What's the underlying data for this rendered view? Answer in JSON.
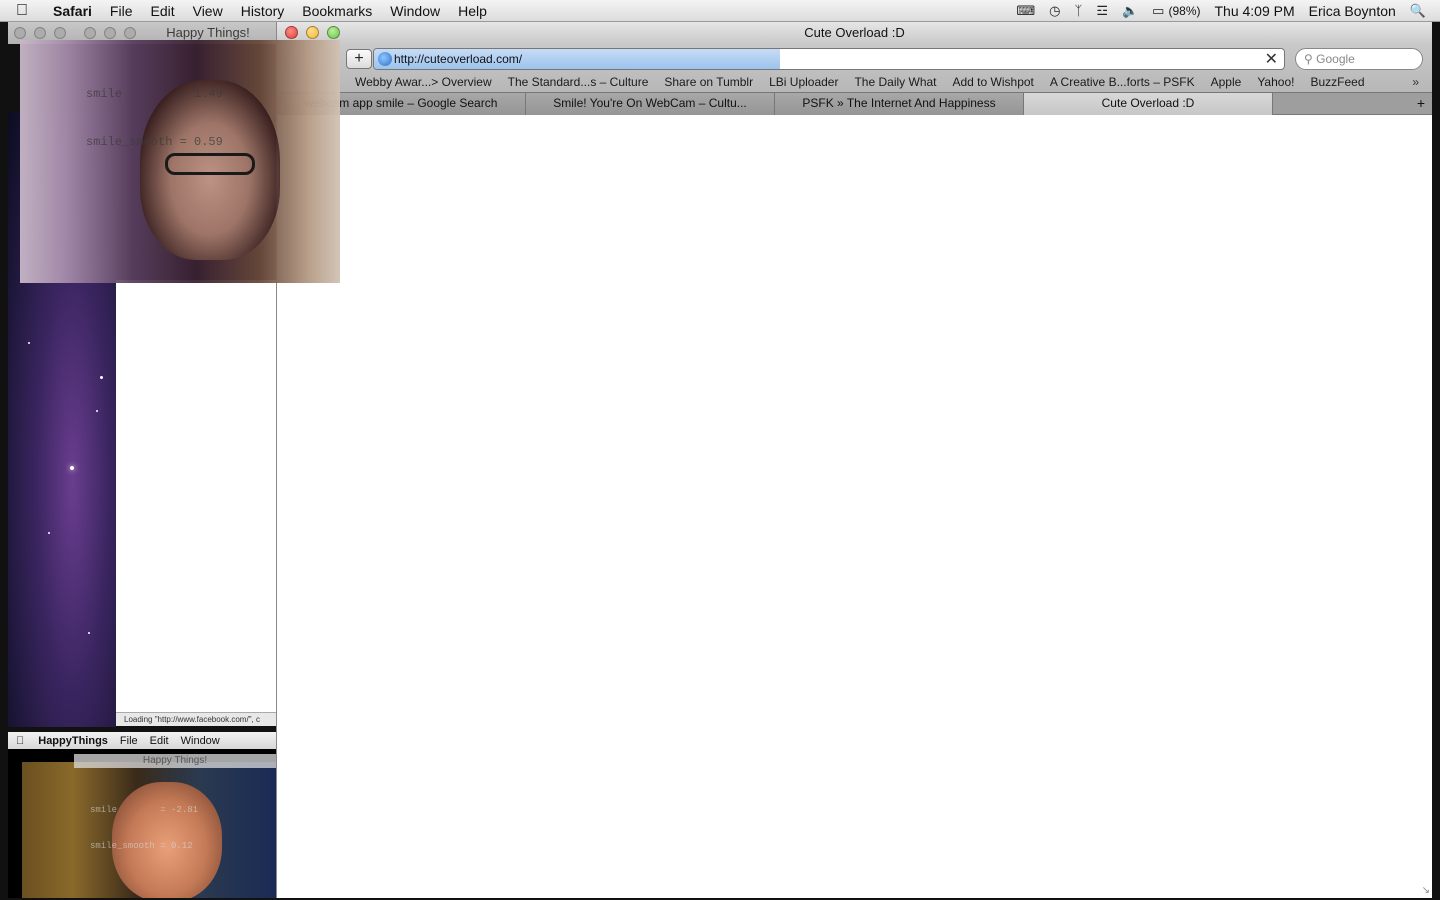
{
  "menubar": {
    "app": "Safari",
    "items": [
      "File",
      "Edit",
      "View",
      "History",
      "Bookmarks",
      "Window",
      "Help"
    ],
    "battery": "(98%)",
    "clock": "Thu 4:09 PM",
    "user": "Erica Boynton"
  },
  "happy_window": {
    "title": "Happy Things!",
    "readout_smile": "smile        = 1.49",
    "readout_smooth": "smile_smooth = 0.59"
  },
  "safari": {
    "title": "Cute Overload :D",
    "url": "http://cuteoverload.com/",
    "search_placeholder": "Google",
    "bookmarks": [
      "Webby Awar...> Overview",
      "The Standard...s – Culture",
      "Share on Tumblr",
      "LBi Uploader",
      "The Daily What",
      "Add to Wishpot",
      "A Creative B...forts – PSFK",
      "Apple",
      "Yahoo!",
      "BuzzFeed"
    ],
    "tabs": [
      {
        "label": "webcam app smile – Google Search",
        "active": false
      },
      {
        "label": "Smile! You're On WebCam – Cultu...",
        "active": false
      },
      {
        "label": "PSFK » The Internet And Happiness",
        "active": false
      },
      {
        "label": "Cute Overload :D",
        "active": true
      }
    ]
  },
  "behind_window": {
    "status": "Loading \"http://www.facebook.com/\", c"
  },
  "mini_screen": {
    "menubar": {
      "app": "HappyThings",
      "items": [
        "File",
        "Edit",
        "Window"
      ]
    },
    "window_title": "Happy Things!",
    "readout_smile": "smile        = -2.81",
    "readout_smooth": "smile_smooth = 0.12"
  },
  "colors": {
    "close": "#e0443e",
    "minimize": "#f5b33a",
    "zoom": "#6cc24a",
    "url_progress": "#9cc3ee"
  }
}
